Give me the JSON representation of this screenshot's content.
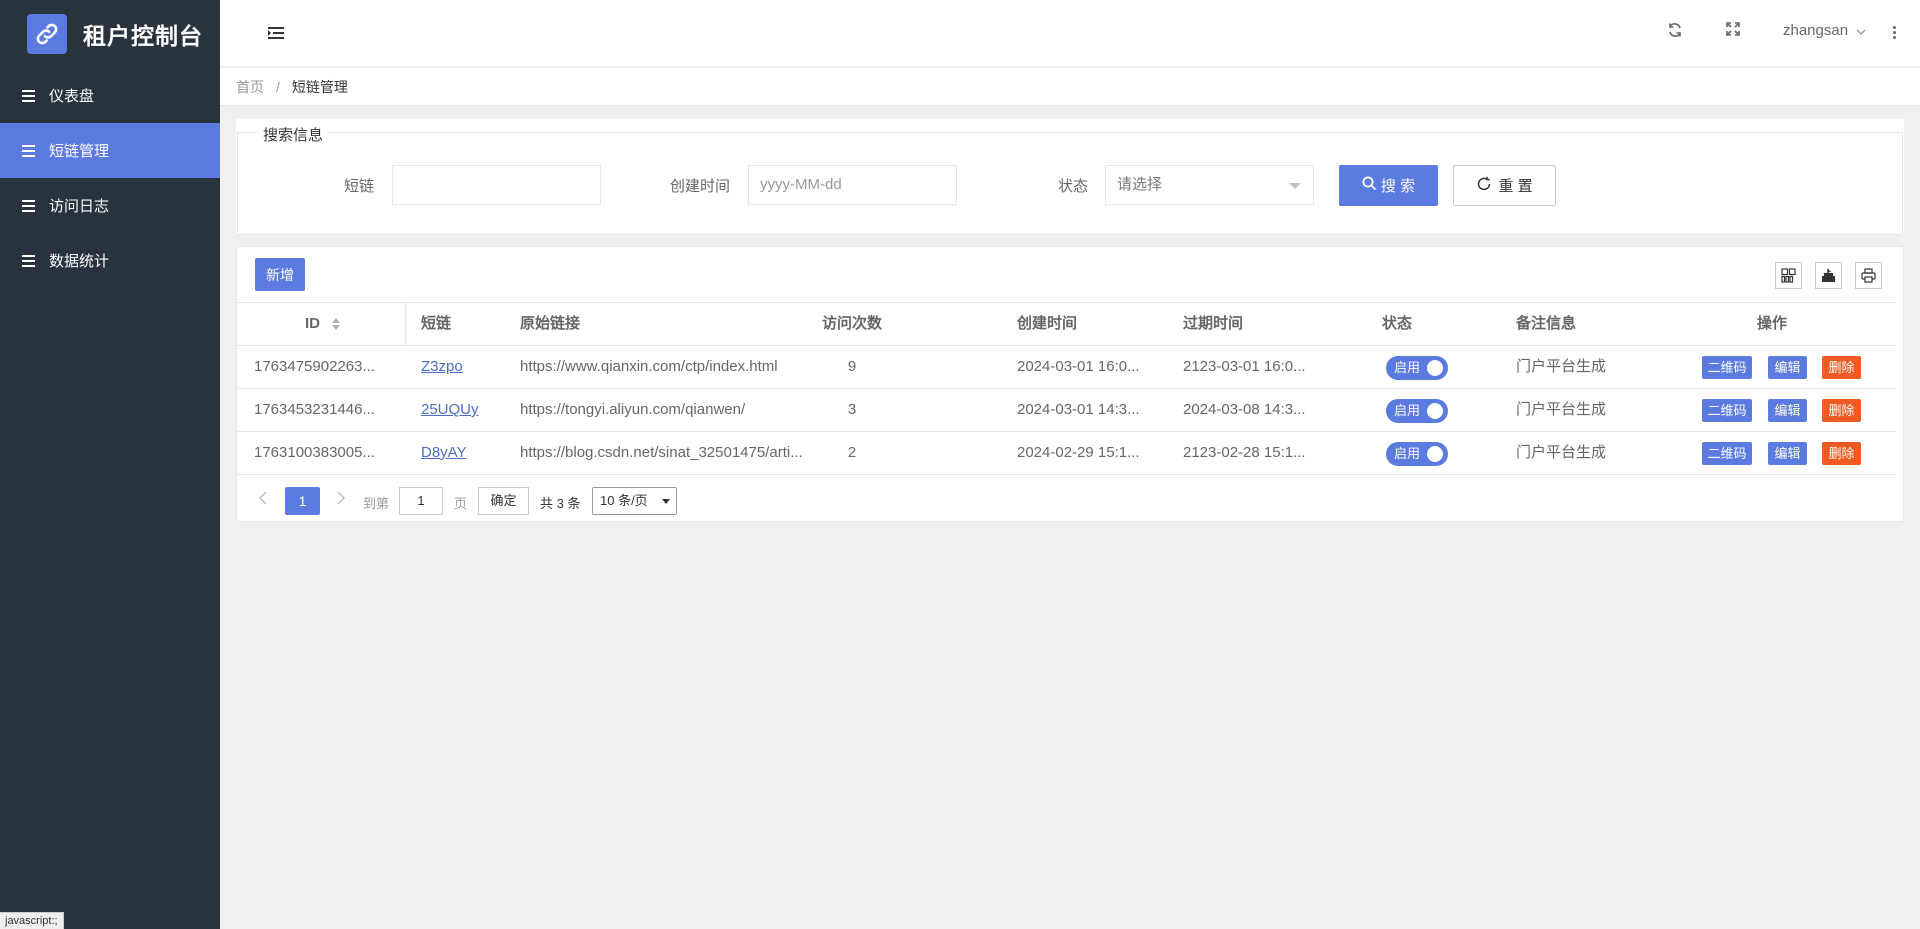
{
  "app": {
    "title": "租户控制台",
    "status_bar_hint": "javascript:;",
    "accent_color": "#5b7be1",
    "danger_color": "#f15a22",
    "sidebar_color": "#28333e"
  },
  "sidebar": {
    "items": [
      {
        "label": "仪表盘",
        "active": false
      },
      {
        "label": "短链管理",
        "active": true
      },
      {
        "label": "访问日志",
        "active": false
      },
      {
        "label": "数据统计",
        "active": false
      }
    ]
  },
  "header": {
    "user": "zhangsan"
  },
  "breadcrumb": {
    "home": "首页",
    "separator": "/",
    "current": "短链管理"
  },
  "search": {
    "legend": "搜索信息",
    "short_label": "短链",
    "short_value": "",
    "date_label": "创建时间",
    "date_placeholder": "yyyy-MM-dd",
    "status_label": "状态",
    "status_placeholder": "请选择",
    "search_button": "搜 索",
    "reset_button": "重 置"
  },
  "toolbar": {
    "add_button": "新增",
    "icons": [
      "columns-icon",
      "export-icon",
      "print-icon"
    ]
  },
  "table": {
    "columns": [
      "ID",
      "短链",
      "原始链接",
      "访问次数",
      "创建时间",
      "过期时间",
      "状态",
      "备注信息",
      "操作"
    ],
    "rows": [
      {
        "id": "1763475902263...",
        "short": "Z3zpo",
        "origin": "https://www.qianxin.com/ctp/index.html",
        "visits": "9",
        "created": "2024-03-01 16:0...",
        "expires": "2123-03-01 16:0...",
        "status": "启用",
        "note": "门户平台生成"
      },
      {
        "id": "1763453231446...",
        "short": "25UQUy",
        "origin": "https://tongyi.aliyun.com/qianwen/",
        "visits": "3",
        "created": "2024-03-01 14:3...",
        "expires": "2024-03-08 14:3...",
        "status": "启用",
        "note": "门户平台生成"
      },
      {
        "id": "1763100383005...",
        "short": "D8yAY",
        "origin": "https://blog.csdn.net/sinat_32501475/arti...",
        "visits": "2",
        "created": "2024-02-29 15:1...",
        "expires": "2123-02-28 15:1...",
        "status": "启用",
        "note": "门户平台生成"
      }
    ],
    "actions": {
      "qr": "二维码",
      "edit": "编辑",
      "delete": "删除"
    }
  },
  "pager": {
    "current_page": "1",
    "goto_label": "到第",
    "goto_value": "1",
    "page_unit": "页",
    "confirm": "确定",
    "total": "共 3 条",
    "page_size": "10 条/页"
  }
}
